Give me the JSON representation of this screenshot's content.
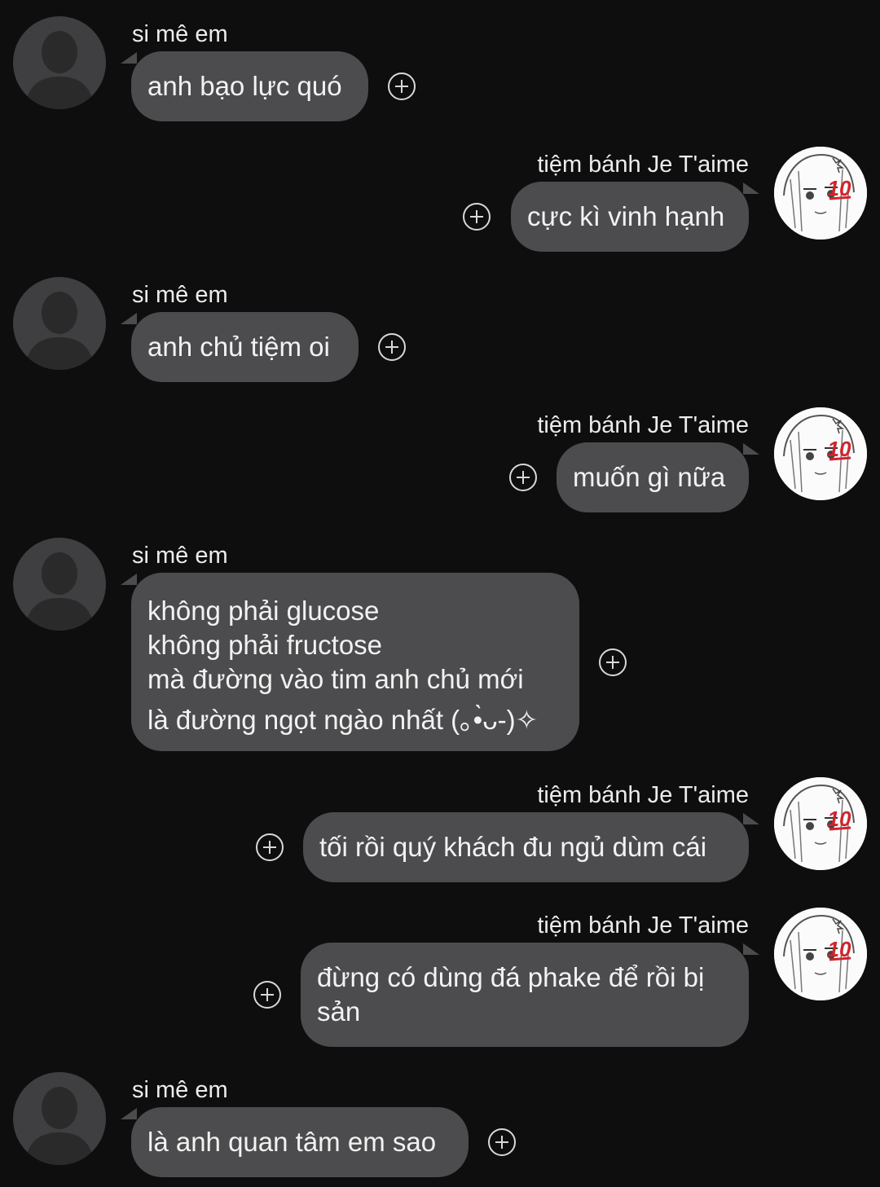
{
  "contacts": {
    "left_name": "si mê em",
    "right_name": "tiệm bánh Je T'aime",
    "right_badge": "10"
  },
  "messages": [
    {
      "sender": "si mê em",
      "side": "left",
      "text": "anh bạo lực quó"
    },
    {
      "sender": "tiệm bánh Je T'aime",
      "side": "right",
      "text": "cực kì vinh hạnh"
    },
    {
      "sender": "si mê em",
      "side": "left",
      "text": "anh chủ tiệm oi"
    },
    {
      "sender": "tiệm bánh Je T'aime",
      "side": "right",
      "text": "muốn gì nữa"
    },
    {
      "sender": "si mê em",
      "side": "left",
      "lines": [
        "không phải glucose",
        "không phải fructose",
        "mà đường vào tim anh chủ mới",
        "là đường ngọt ngào nhất (｡•̀ᴗ-)✧"
      ]
    },
    {
      "sender": "tiệm bánh Je T'aime",
      "side": "right",
      "text": "tối rồi quý khách đu ngủ dùm cái"
    },
    {
      "sender": "tiệm bánh Je T'aime",
      "side": "right",
      "lines": [
        "đừng có dùng đá phake để rồi bị",
        "sản"
      ]
    },
    {
      "sender": "si mê em",
      "side": "left",
      "text": "là anh quan tâm em sao"
    }
  ],
  "icons": {
    "reaction": "add-reaction-icon",
    "default_avatar": "default-avatar-icon",
    "anime_avatar": "anime-avatar-icon"
  },
  "colors": {
    "background": "#0e0e0f",
    "bubble": "#4c4c4e",
    "text": "#f2f2f2",
    "badge": "#d0242c"
  }
}
